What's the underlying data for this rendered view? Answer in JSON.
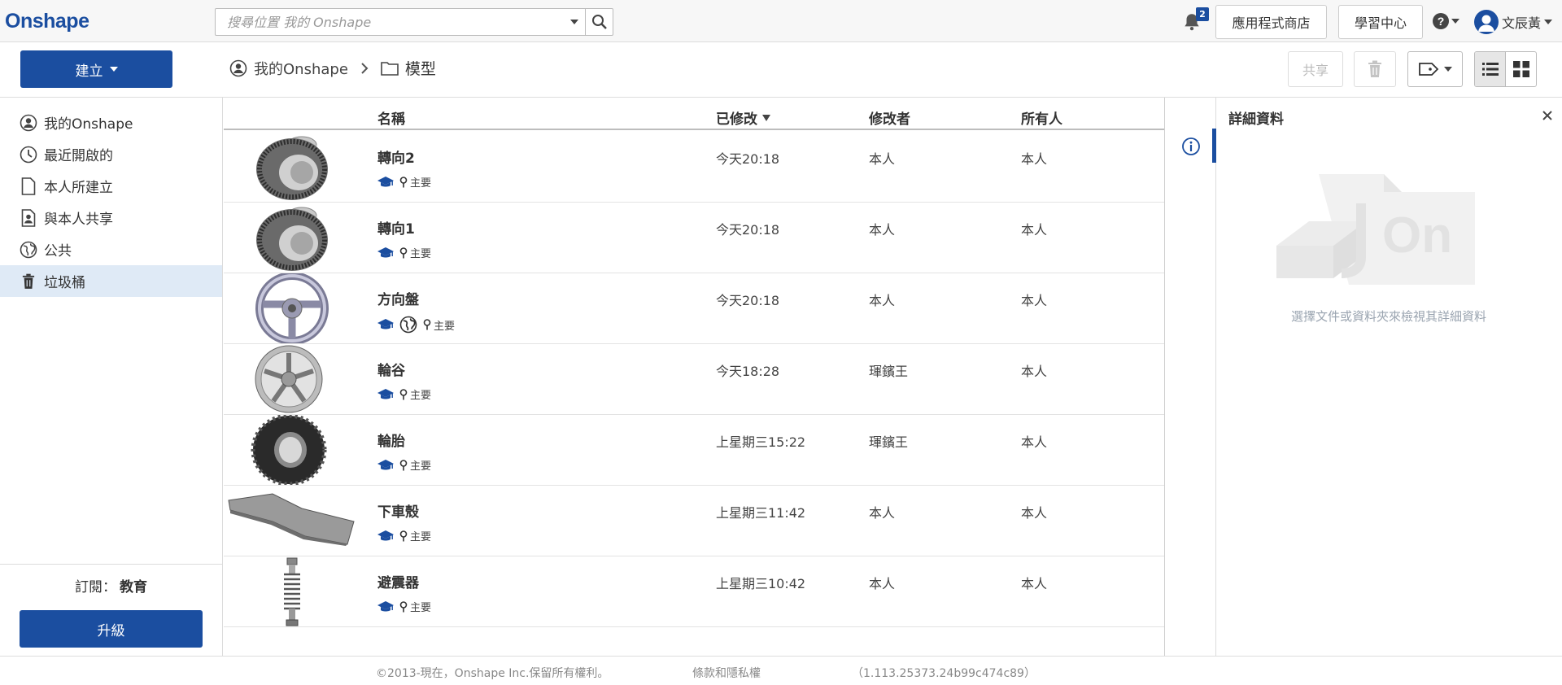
{
  "app": {
    "logo": "Onshape",
    "brand_color": "#1b4ea0"
  },
  "header": {
    "search_placeholder": "搜尋位置 我的 Onshape",
    "notifications_count": "2",
    "app_store_label": "應用程式商店",
    "learning_center_label": "學習中心",
    "user_name": "文辰黃"
  },
  "toolbar": {
    "create_label": "建立",
    "share_label": "共享",
    "breadcrumb": [
      "我的Onshape",
      "模型"
    ]
  },
  "sidebar": {
    "items": [
      {
        "label": "我的Onshape",
        "icon": "user-circle-icon"
      },
      {
        "label": "最近開啟的",
        "icon": "clock-icon"
      },
      {
        "label": "本人所建立",
        "icon": "document-icon"
      },
      {
        "label": "與本人共享",
        "icon": "shared-user-icon"
      },
      {
        "label": "公共",
        "icon": "globe-icon"
      },
      {
        "label": "垃圾桶",
        "icon": "trash-icon",
        "active": true
      }
    ],
    "subscription_label": "訂閱：",
    "subscription_value": "教育",
    "upgrade_label": "升級"
  },
  "table": {
    "columns": {
      "name": "名稱",
      "modified": "已修改",
      "modified_by": "修改者",
      "owner": "所有人"
    },
    "sort_column": "modified",
    "rows": [
      {
        "name": "轉向2",
        "modified": "今天20:18",
        "modified_by": "本人",
        "owner": "本人",
        "branch": "主要",
        "public": false,
        "thumb": "bevel-gear"
      },
      {
        "name": "轉向1",
        "modified": "今天20:18",
        "modified_by": "本人",
        "owner": "本人",
        "branch": "主要",
        "public": false,
        "thumb": "bevel-gear"
      },
      {
        "name": "方向盤",
        "modified": "今天20:18",
        "modified_by": "本人",
        "owner": "本人",
        "branch": "主要",
        "public": true,
        "thumb": "steering-wheel"
      },
      {
        "name": "輪谷",
        "modified": "今天18:28",
        "modified_by": "琿鑌王",
        "owner": "本人",
        "branch": "主要",
        "public": false,
        "thumb": "rim"
      },
      {
        "name": "輪胎",
        "modified": "上星期三15:22",
        "modified_by": "琿鑌王",
        "owner": "本人",
        "branch": "主要",
        "public": false,
        "thumb": "tire"
      },
      {
        "name": "下車殼",
        "modified": "上星期三11:42",
        "modified_by": "本人",
        "owner": "本人",
        "branch": "主要",
        "public": false,
        "thumb": "plate"
      },
      {
        "name": "避震器",
        "modified": "上星期三10:42",
        "modified_by": "本人",
        "owner": "本人",
        "branch": "主要",
        "public": false,
        "thumb": "shock"
      }
    ]
  },
  "details": {
    "title": "詳細資料",
    "empty_message": "選擇文件或資料夾來檢視其詳細資料"
  },
  "footer": {
    "copyright": "©2013-現在，Onshape Inc.保留所有權利。",
    "terms": "條款和隱私權",
    "version": "（1.113.25373.24b99c474c89）"
  }
}
